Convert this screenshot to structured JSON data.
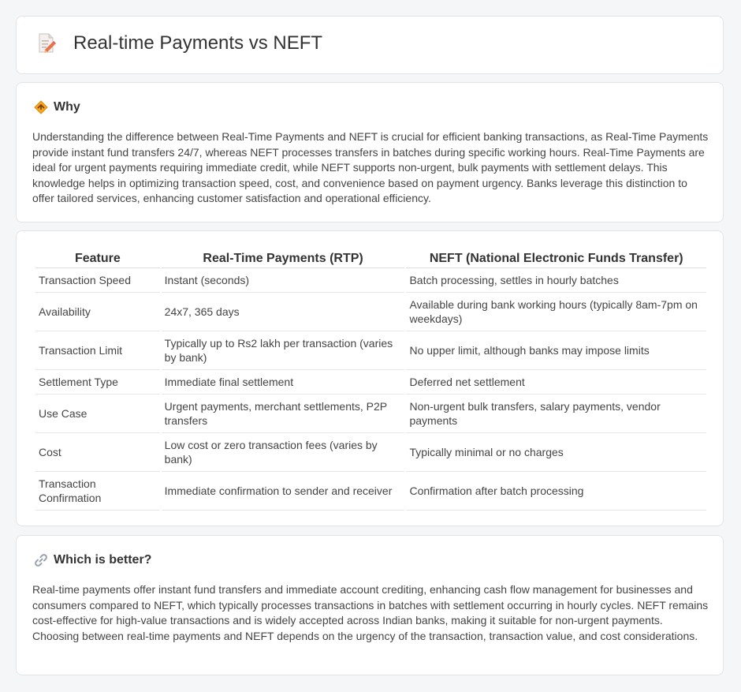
{
  "page": {
    "title": "Real-time Payments vs NEFT",
    "title_icon": "document-pencil-icon"
  },
  "why": {
    "heading": "Why",
    "icon": "diamond-arrow-icon",
    "text": "Understanding the difference between Real-Time Payments and NEFT is crucial for efficient banking transactions, as Real-Time Payments provide instant fund transfers 24/7, whereas NEFT processes transfers in batches during specific working hours. Real-Time Payments are ideal for urgent payments requiring immediate credit, while NEFT supports non-urgent, bulk payments with settlement delays. This knowledge helps in optimizing transaction speed, cost, and convenience based on payment urgency. Banks leverage this distinction to offer tailored services, enhancing customer satisfaction and operational efficiency."
  },
  "table": {
    "headers": [
      "Feature",
      "Real-Time Payments (RTP)",
      "NEFT (National Electronic Funds Transfer)"
    ],
    "rows": [
      [
        "Transaction Speed",
        "Instant (seconds)",
        "Batch processing, settles in hourly batches"
      ],
      [
        "Availability",
        "24x7, 365 days",
        "Available during bank working hours (typically 8am-7pm on weekdays)"
      ],
      [
        "Transaction Limit",
        "Typically up to Rs2 lakh per transaction (varies by bank)",
        "No upper limit, although banks may impose limits"
      ],
      [
        "Settlement Type",
        "Immediate final settlement",
        "Deferred net settlement"
      ],
      [
        "Use Case",
        "Urgent payments, merchant settlements, P2P transfers",
        "Non-urgent bulk transfers, salary payments, vendor payments"
      ],
      [
        "Cost",
        "Low cost or zero transaction fees (varies by bank)",
        "Typically minimal or no charges"
      ],
      [
        "Transaction Confirmation",
        "Immediate confirmation to sender and receiver",
        "Confirmation after batch processing"
      ]
    ]
  },
  "better": {
    "heading": "Which is better?",
    "icon": "link-icon",
    "text": "Real-time payments offer instant fund transfers and immediate account crediting, enhancing cash flow management for businesses and consumers compared to NEFT, which typically processes transactions in batches with settlement occurring in hourly cycles. NEFT remains cost-effective for high-value transactions and is widely accepted across Indian banks, making it suitable for non-urgent payments. Choosing between real-time payments and NEFT depends on the urgency of the transaction, transaction value, and cost considerations."
  }
}
